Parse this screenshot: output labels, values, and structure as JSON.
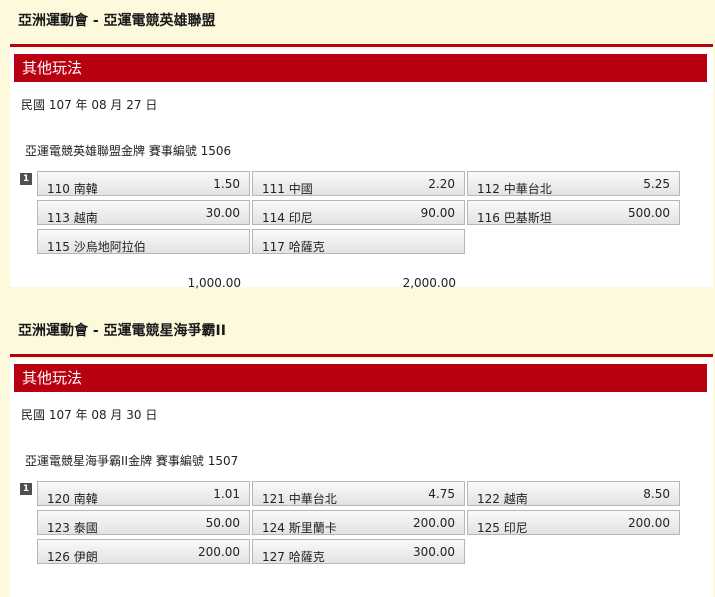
{
  "sections": [
    {
      "title": "亞洲運動會 - 亞運電競英雄聯盟",
      "bar_label": "其他玩法",
      "date": "民國 107 年 08 月 27 日",
      "event": "亞運電競英雄聯盟金牌 賽事編號 1506",
      "badge": "1",
      "options": [
        {
          "name": "110 南韓",
          "odds": "1.50"
        },
        {
          "name": "111 中國",
          "odds": "2.20"
        },
        {
          "name": "112 中華台北",
          "odds": "5.25"
        },
        {
          "name": "113 越南",
          "odds": "30.00"
        },
        {
          "name": "114 印尼",
          "odds": "90.00"
        },
        {
          "name": "116 巴基斯坦",
          "odds": "500.00"
        },
        {
          "name": "115 沙烏地阿拉伯",
          "odds": ""
        },
        {
          "name": "117 哈薩克",
          "odds": ""
        }
      ],
      "totals": [
        "1,000.00",
        "2,000.00"
      ]
    },
    {
      "title": "亞洲運動會 - 亞運電競星海爭霸II",
      "bar_label": "其他玩法",
      "date": "民國 107 年 08 月 30 日",
      "event": "亞運電競星海爭霸II金牌 賽事編號 1507",
      "badge": "1",
      "options": [
        {
          "name": "120 南韓",
          "odds": "1.01"
        },
        {
          "name": "121 中華台北",
          "odds": "4.75"
        },
        {
          "name": "122 越南",
          "odds": "8.50"
        },
        {
          "name": "123 泰國",
          "odds": "50.00"
        },
        {
          "name": "124 斯里蘭卡",
          "odds": "200.00"
        },
        {
          "name": "125 印尼",
          "odds": "200.00"
        },
        {
          "name": "126 伊朗",
          "odds": "200.00"
        },
        {
          "name": "127 哈薩克",
          "odds": "300.00"
        }
      ]
    }
  ]
}
